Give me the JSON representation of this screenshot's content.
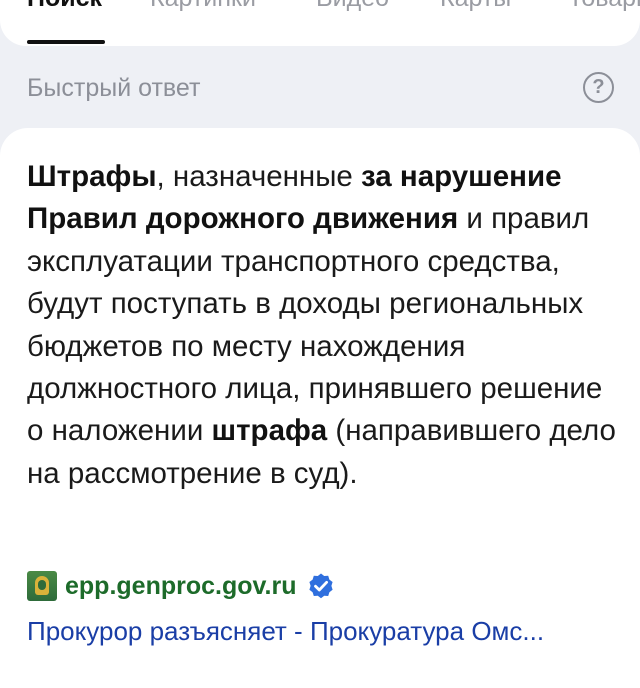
{
  "tabs": {
    "items": [
      "Поиск",
      "Картинки",
      "Видео",
      "Карты",
      "Товары"
    ],
    "active": "Поиск"
  },
  "quick_answer": {
    "label": "Быстрый ответ",
    "help_icon": "question-circle-icon",
    "segments": [
      {
        "text": "Штрафы",
        "bold": true
      },
      {
        "text": ", назначенные ",
        "bold": false
      },
      {
        "text": "за нарушение Правил дорожного движения",
        "bold": true
      },
      {
        "text": " и правил эксплуатации транспортного средства, будут поступать в доходы региональных бюджетов по месту нахождения должностного лица, принявшего решение о наложении ",
        "bold": false
      },
      {
        "text": "штрафа",
        "bold": true
      },
      {
        "text": " (направившего дело на рассмотрение в суд).",
        "bold": false
      }
    ]
  },
  "source": {
    "domain": "epp.genproc.gov.ru",
    "verified_icon": "verified-check-icon",
    "favicon": "emblem-favicon",
    "title": "Прокурор разъясняет - Прокуратура Омс..."
  },
  "colors": {
    "background": "#eef0f5",
    "card": "#ffffff",
    "domain_green": "#1d6b2a",
    "link_blue": "#1a3ea6",
    "verified_blue": "#2f6fde",
    "muted": "#8c8f98"
  }
}
